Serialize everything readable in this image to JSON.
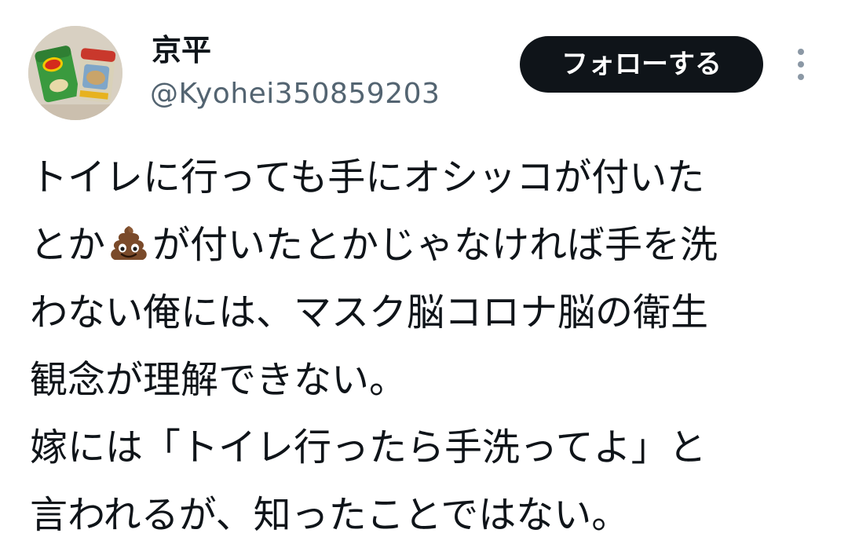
{
  "user": {
    "name": "京平",
    "handle": "@Kyohei350859203",
    "avatar_icon": "avatar-chips-photo"
  },
  "actions": {
    "follow_label": "フォローする",
    "more_icon": "more-vertical-icon"
  },
  "tweet": {
    "lines": [
      {
        "text": "トイレに行っても手にオシッコが付いた"
      },
      {
        "before": "とか",
        "emoji": "pile-of-poo-emoji",
        "after": "が付いたとかじゃなければ手を洗"
      },
      {
        "text": "わない俺には、マスク脳コロナ脳の衛生"
      },
      {
        "text": "観念が理解できない。"
      },
      {
        "text": "嫁には「トイレ行ったら手洗ってよ」と"
      },
      {
        "text": "言われるが、知ったことではない。"
      }
    ]
  },
  "colors": {
    "text": "#0f1419",
    "secondary_text": "#536471",
    "button_bg": "#0f1419",
    "button_text": "#ffffff",
    "more_dots": "#8b98a5",
    "emoji_brown": "#7a4a2a"
  }
}
